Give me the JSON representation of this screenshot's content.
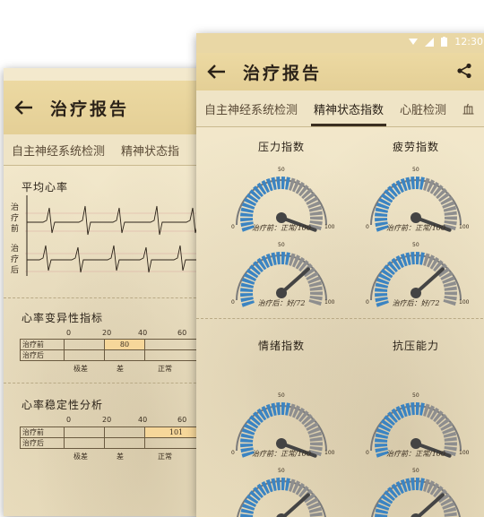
{
  "colors": {
    "appbar": "#e4cf96",
    "paper": "#f1e6c8",
    "gauge_blue": "#3b84c2",
    "gauge_grey": "#8e8e8e",
    "ink": "#2b2218",
    "highlight": "#f6d79a"
  },
  "status_bar": {
    "time": "12:30"
  },
  "back_screen": {
    "title": "治疗报告",
    "tabs": [
      "自主神经系统检测",
      "精神状态指"
    ],
    "avg_heart_rate": {
      "title": "平均心率",
      "before_label": "治疗前",
      "after_label": "治疗后"
    },
    "hrv": {
      "title": "心率变异性指标",
      "axis": [
        "0",
        "20",
        "40",
        "60"
      ],
      "rows": [
        "治疗前",
        "治疗后"
      ],
      "value": "80",
      "scale_labels": [
        "极差",
        "差",
        "正常"
      ]
    },
    "stability": {
      "title": "心率稳定性分析",
      "axis": [
        "0",
        "20",
        "40",
        "60"
      ],
      "rows": [
        "治疗前",
        "治疗后"
      ],
      "value": "101",
      "scale_labels": [
        "极差",
        "差",
        "正常"
      ]
    }
  },
  "front_screen": {
    "title": "治疗报告",
    "tabs": [
      "自主神经系统检测",
      "精神状态指数",
      "心脏检测",
      "血"
    ],
    "active_tab": 1,
    "gauges": [
      {
        "title": "压力指数",
        "caption": "治疗前：正常/100",
        "value": 100,
        "min": "0",
        "mid": "50",
        "max": "100"
      },
      {
        "title": "疲劳指数",
        "caption": "治疗前：正常/100",
        "value": 100,
        "min": "0",
        "mid": "50",
        "max": "100"
      },
      {
        "title": "",
        "caption": "治疗后：好/72",
        "value": 72,
        "min": "0",
        "mid": "50",
        "max": "100"
      },
      {
        "title": "",
        "caption": "治疗后：好/72",
        "value": 72,
        "min": "0",
        "mid": "50",
        "max": "100"
      },
      {
        "title": "情绪指数",
        "caption": "治疗前：正常/100",
        "value": 100,
        "min": "0",
        "mid": "50",
        "max": "100"
      },
      {
        "title": "抗压能力",
        "caption": "治疗前：正常/100",
        "value": 100,
        "min": "0",
        "mid": "50",
        "max": "100"
      },
      {
        "title": "",
        "caption": "",
        "value": 72,
        "min": "",
        "mid": "50",
        "max": ""
      },
      {
        "title": "",
        "caption": "",
        "value": 72,
        "min": "",
        "mid": "50",
        "max": ""
      }
    ]
  }
}
